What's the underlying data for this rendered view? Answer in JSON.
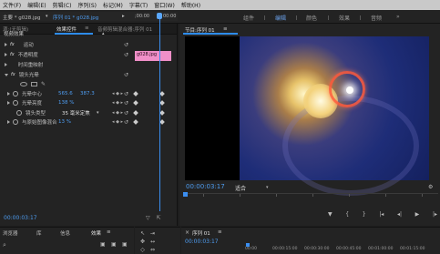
{
  "menu": [
    "文件(F)",
    "编辑(E)",
    "剪辑(C)",
    "序列(S)",
    "标记(M)",
    "字幕(T)",
    "窗口(W)",
    "帮助(H)"
  ],
  "workspace": {
    "items": [
      "组件",
      "编辑",
      "颜色",
      "效果",
      "音频"
    ],
    "active": "编辑"
  },
  "left_tabs": {
    "source": "源:(无剪辑)",
    "effect_controls": "效果控件",
    "mixer": "音频剪辑混合器:序列 01"
  },
  "clip_header": {
    "master": "主要 * g028.jpg",
    "sequence": "序列 01 * g028.jpg",
    "time_start": ";00:00",
    "time_end": "00:00"
  },
  "clip_name": "g028.jpg",
  "video_effects_label": "视频效果",
  "effects": [
    {
      "name": "运动",
      "expanded": false
    },
    {
      "name": "不透明度",
      "expanded": false
    },
    {
      "name": "时间重映射",
      "expanded": false
    },
    {
      "name": "镜头光晕",
      "expanded": true
    }
  ],
  "lens_flare": {
    "center_label": "光晕中心",
    "center_x": "565.6",
    "center_y": "387.3",
    "brightness_label": "光晕亮度",
    "brightness_value": "138 %",
    "lens_type_label": "镜头类型",
    "lens_type_value": "35 毫米定焦",
    "blend_label": "与原始图像混合",
    "blend_value": "13 %"
  },
  "left_timecode": "00:00:03:17",
  "monitor": {
    "title": "节目:序列 01",
    "timecode": "00:00:03:17",
    "fit": "适合"
  },
  "bottom_left_tabs": [
    "浏览器",
    "库",
    "信息",
    "效果"
  ],
  "bottom_right": {
    "sequence_tab": "序列 01",
    "timecode": "00:00:03:17",
    "ruler_marks": [
      "00:00",
      "00:00:15:00",
      "00:00:30:00",
      "00:00:45:00",
      "00:01:00:00",
      "00:01:15:00"
    ]
  }
}
